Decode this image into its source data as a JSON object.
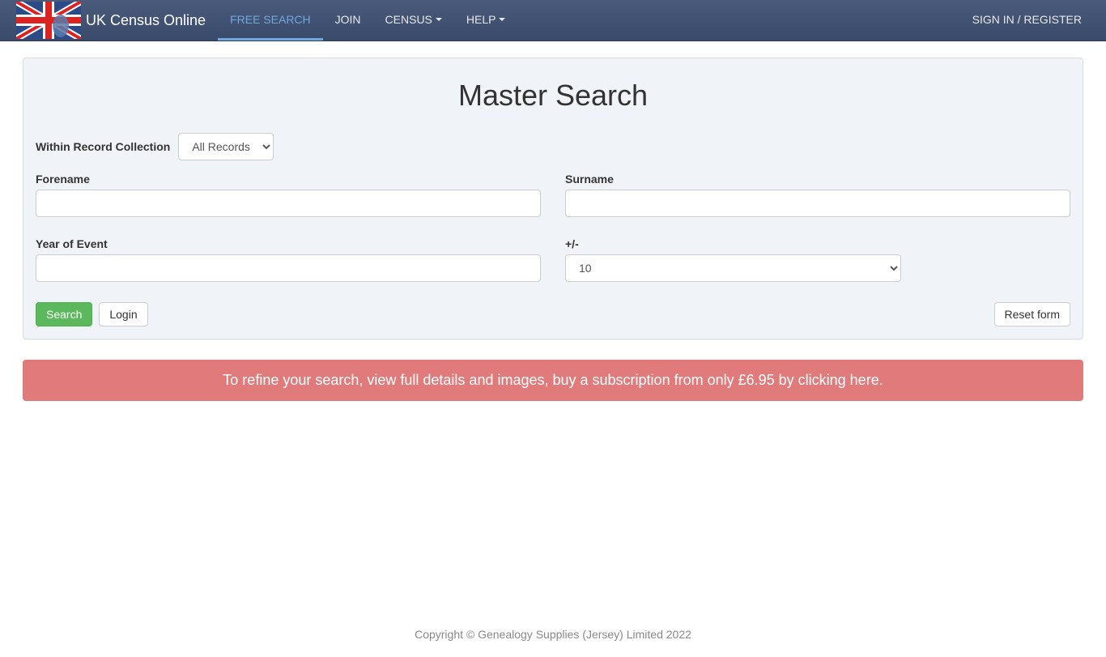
{
  "navbar": {
    "brand": "UK Census Online",
    "items": [
      {
        "label": "FREE SEARCH",
        "active": true
      },
      {
        "label": "JOIN",
        "active": false
      },
      {
        "label": "CENSUS",
        "active": false,
        "dropdown": true
      },
      {
        "label": "HELP",
        "active": false,
        "dropdown": true
      }
    ],
    "signin": "SIGN IN / REGISTER"
  },
  "panel": {
    "title": "Master Search",
    "collection_label": "Within Record Collection",
    "collection_selected": "All Records",
    "forename_label": "Forename",
    "surname_label": "Surname",
    "year_label": "Year of Event",
    "tolerance_label": "+/-",
    "tolerance_selected": "10",
    "search_btn": "Search",
    "login_btn": "Login",
    "reset_btn": "Reset form"
  },
  "alert": {
    "text": "To refine your search, view full details and images, buy a subscription from only £6.95 by clicking here."
  },
  "footer": {
    "text": "Copyright © Genealogy Supplies (Jersey) Limited 2022"
  }
}
